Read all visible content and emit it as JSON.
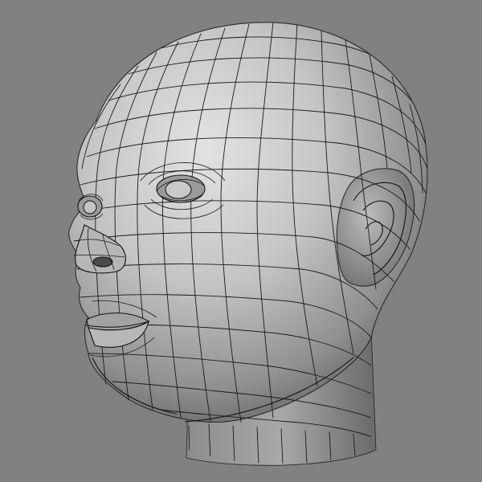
{
  "scene": {
    "subject_icon": "wireframe-head-model-icon",
    "colors": {
      "background": "#818181",
      "surface_light": "#d8d8d8",
      "surface_mid": "#a9a9a9",
      "surface_dark": "#555555",
      "wire": "#1a1a1a"
    }
  }
}
